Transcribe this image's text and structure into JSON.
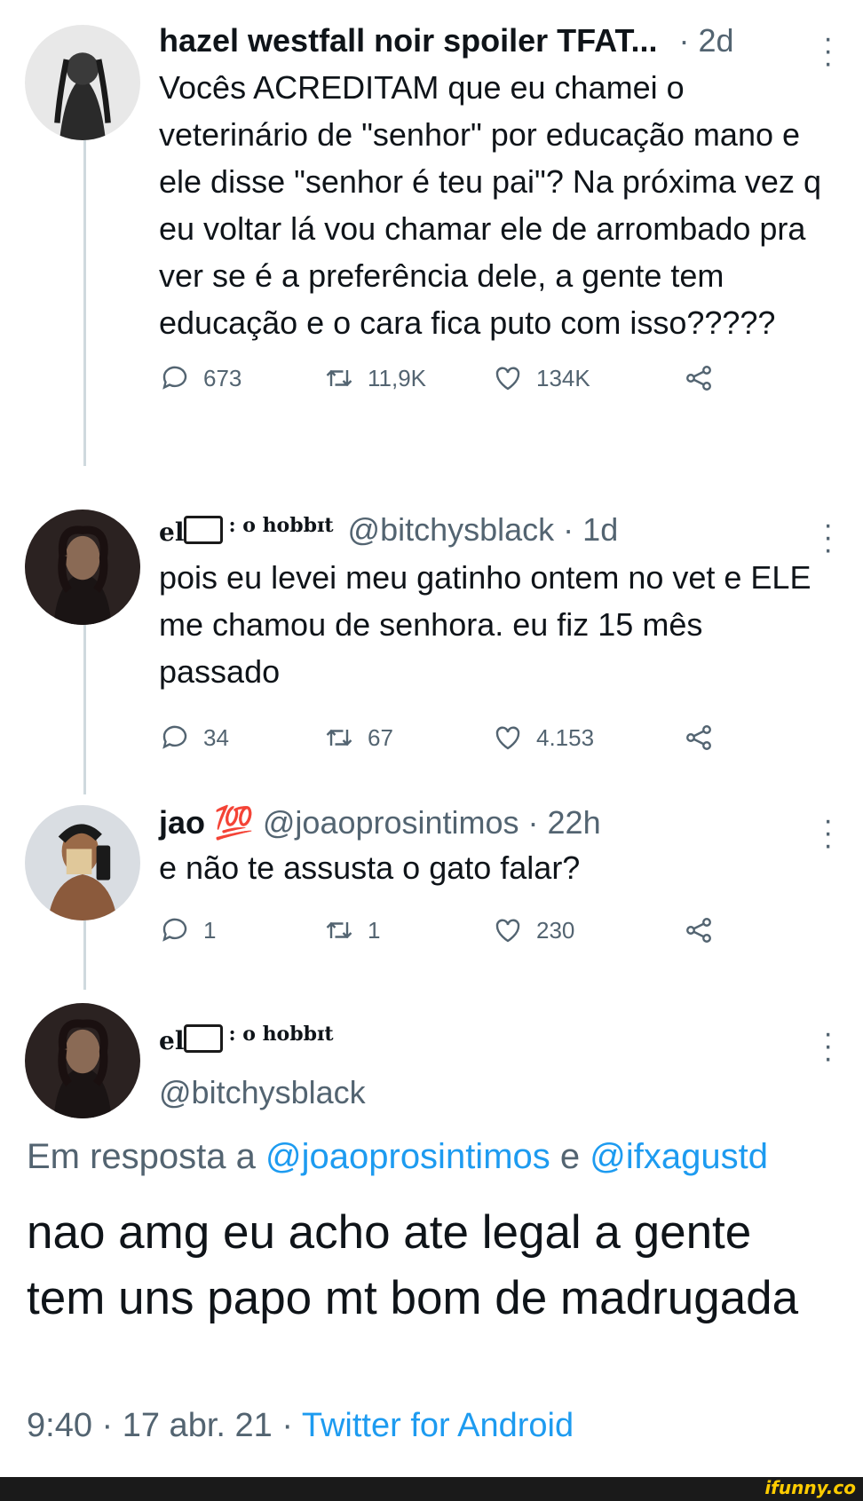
{
  "tweets": [
    {
      "name": "hazel westfall noir spoiler TFAT...",
      "time": "· 2d",
      "text": "Vocês ACREDITAM que eu chamei o veterinário de \"senhor\" por educação mano e ele disse \"senhor é teu pai\"? Na próxima vez q eu voltar lá vou chamar ele de arrombado pra ver se é a preferência dele, a gente tem educação e o cara fica puto com isso?????",
      "replies": "673",
      "retweets": "11,9K",
      "likes": "134K"
    },
    {
      "name_prefix": "el",
      "name_suffix": ": o hobbɪt",
      "handle": "@bitchysblack · 1d",
      "text": "pois eu levei meu gatinho ontem no vet e ELE me chamou de senhora. eu fiz 15 mês passado",
      "replies": "34",
      "retweets": "67",
      "likes": "4.153"
    },
    {
      "name": "jao",
      "emoji": "💯",
      "handle": "@joaoprosintimos · 22h",
      "text": "e não te assusta o gato falar?",
      "replies": "1",
      "retweets": "1",
      "likes": "230"
    }
  ],
  "main": {
    "name_prefix": "el",
    "name_suffix": ": o hobbɪt",
    "handle": "@bitchysblack",
    "reply_prefix": "Em resposta a",
    "reply_user1": "@joaoprosintimos",
    "reply_and": "e",
    "reply_user2": "@ifxagustd",
    "text": "nao amg eu acho ate legal  a gente tem uns papo mt bom de madrugada",
    "time": "9:40 · 17 abr. 21 ·",
    "source": "Twitter for Android"
  },
  "watermark": "ifunny.co",
  "colors": {
    "link": "#1d9bf0",
    "secondary": "#536471",
    "text": "#0f1419"
  },
  "icons": [
    "reply-icon",
    "retweet-icon",
    "like-icon",
    "share-icon",
    "more-icon"
  ]
}
